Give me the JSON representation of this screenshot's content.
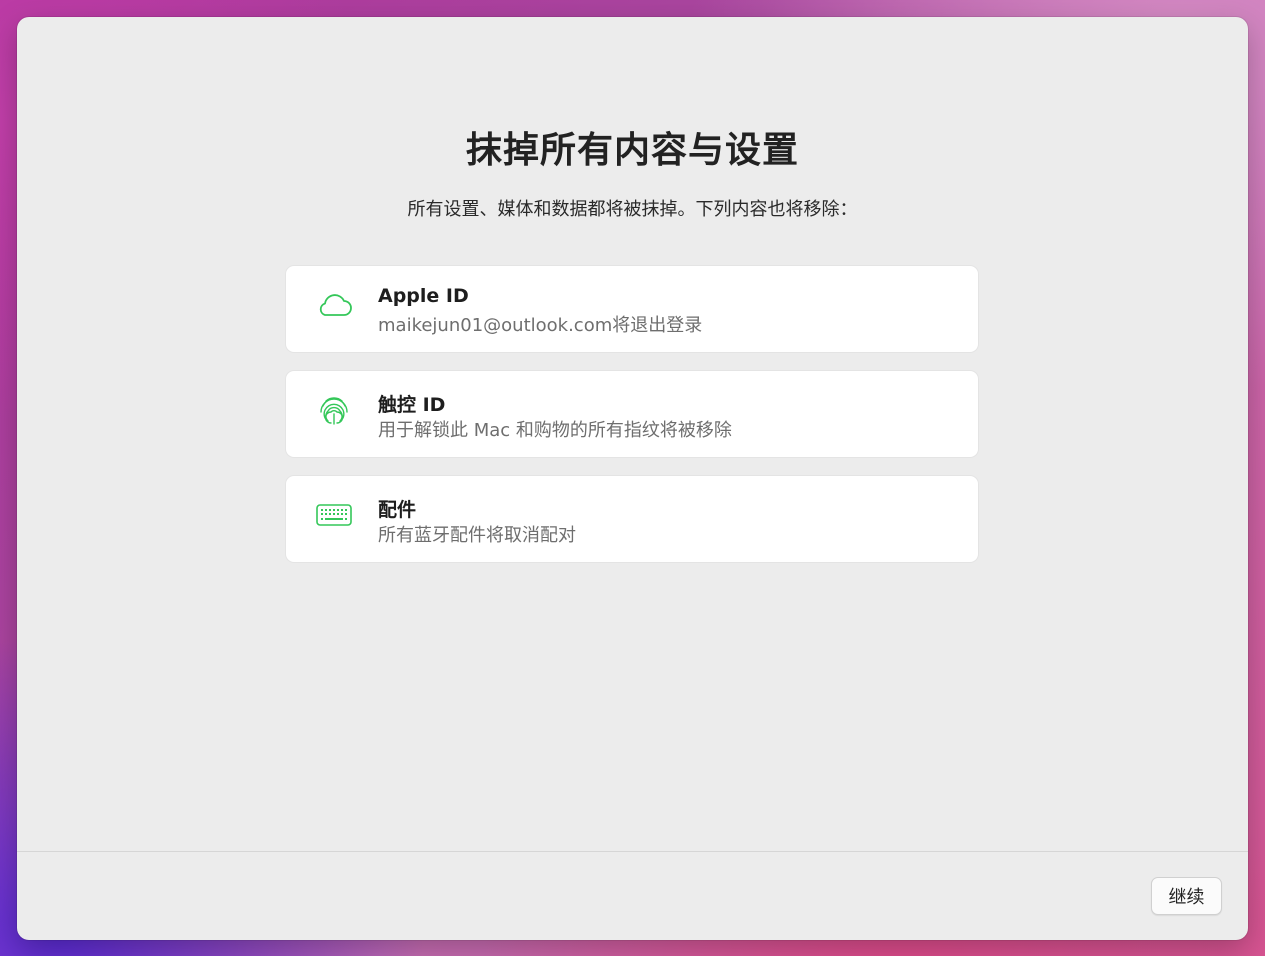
{
  "title": "抹掉所有内容与设置",
  "subtitle": "所有设置、媒体和数据都将被抹掉。下列内容也将移除：",
  "items": [
    {
      "icon": "cloud-icon",
      "title": "Apple ID",
      "description": "maikejun01@outlook.com将退出登录"
    },
    {
      "icon": "fingerprint-icon",
      "title": "触控 ID",
      "description": "用于解锁此 Mac 和购物的所有指纹将被移除"
    },
    {
      "icon": "keyboard-icon",
      "title": "配件",
      "description": "所有蓝牙配件将取消配对"
    }
  ],
  "buttons": {
    "continue_label": "继续"
  },
  "colors": {
    "icon_accent": "#34c759",
    "window_bg": "#ececec",
    "card_bg": "#ffffff"
  }
}
